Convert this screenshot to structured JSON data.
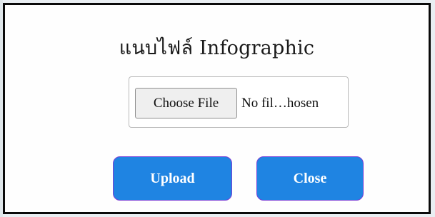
{
  "dialog": {
    "title": "แนบไฟล์ Infographic",
    "file_input": {
      "button_label": "Choose File",
      "status_text": "No fil…hosen"
    },
    "buttons": {
      "upload_label": "Upload",
      "close_label": "Close"
    },
    "colors": {
      "primary_button": "#1f84e2",
      "frame_border": "#0a0a0a"
    }
  }
}
